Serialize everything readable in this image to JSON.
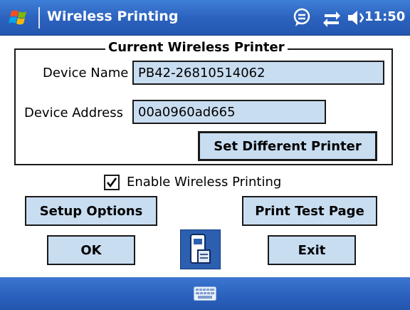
{
  "header": {
    "app_title": "Wireless Printing",
    "clock": "11:50",
    "icons": [
      "windows-start-icon",
      "notification-chat-icon",
      "connectivity-icon",
      "volume-icon"
    ]
  },
  "printer_group": {
    "legend": "Current Wireless Printer",
    "device_name_label": "Device Name",
    "device_name_value": "PB42-26810514062",
    "device_address_label": "Device Address",
    "device_address_value": "00a0960ad665",
    "set_printer_button": "Set Different Printer"
  },
  "enable_wireless": {
    "label": "Enable Wireless Printing",
    "checked": true
  },
  "buttons": {
    "setup_options": "Setup Options",
    "print_test_page": "Print Test Page",
    "ok": "OK",
    "exit": "Exit"
  },
  "footer": {
    "icons": [
      "keyboard-icon"
    ]
  },
  "colors": {
    "titlebar": "#2c63bf",
    "field_bg": "#c9ddf1",
    "icon_button_bg": "#2c5fb0"
  }
}
